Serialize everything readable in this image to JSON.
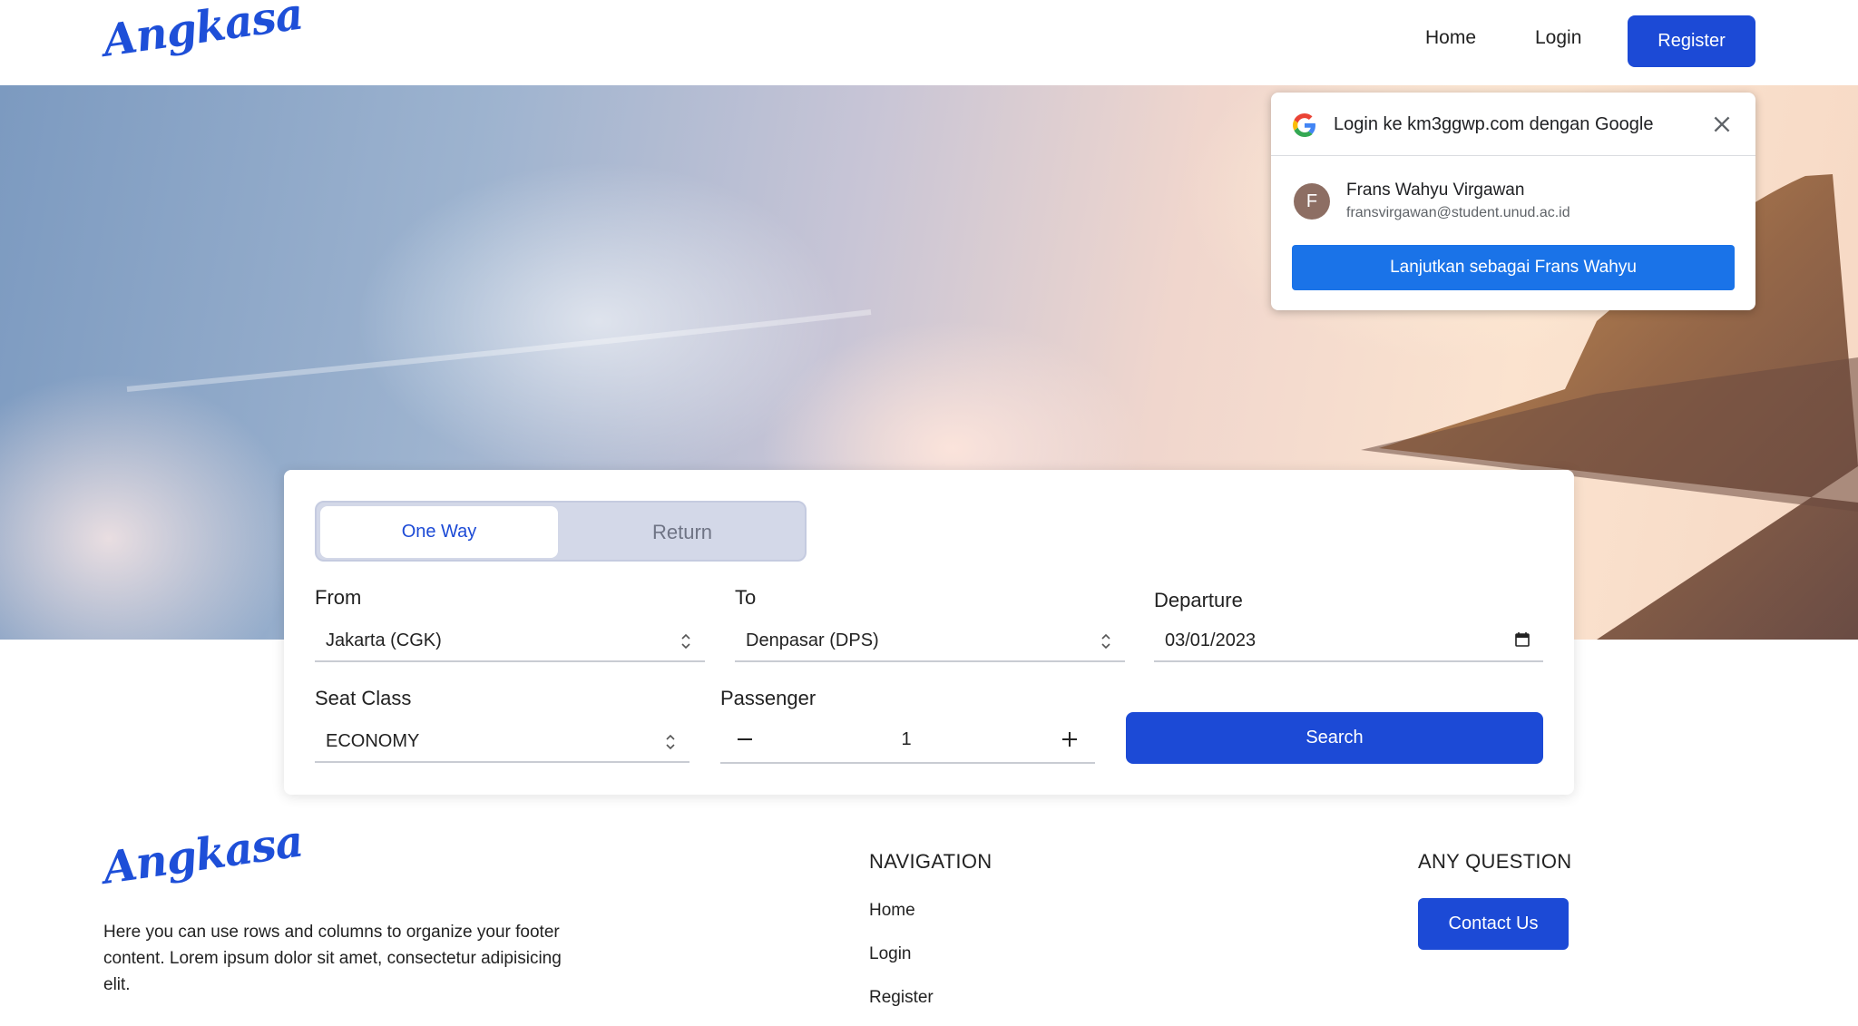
{
  "brand": {
    "logo_text": "Angkasa",
    "accent_color": "#1c4ad6"
  },
  "nav": {
    "home": "Home",
    "login": "Login",
    "register": "Register"
  },
  "google_prompt": {
    "title": "Login ke km3ggwp.com dengan Google",
    "avatar_initial": "F",
    "account_name": "Frans Wahyu Virgawan",
    "account_email": "fransvirgawan@student.unud.ac.id",
    "continue_label": "Lanjutkan sebagai Frans Wahyu",
    "button_color": "#1a73e8"
  },
  "search": {
    "trip_type": {
      "one_way": "One Way",
      "return": "Return",
      "selected": "One Way"
    },
    "from": {
      "label": "From",
      "value": "Jakarta (CGK)"
    },
    "to": {
      "label": "To",
      "value": "Denpasar (DPS)"
    },
    "departure": {
      "label": "Departure",
      "value": "03/01/2023"
    },
    "seat_class": {
      "label": "Seat Class",
      "value": "ECONOMY"
    },
    "passenger": {
      "label": "Passenger",
      "value": "1"
    },
    "search_label": "Search"
  },
  "footer": {
    "logo_text": "Angkasa",
    "description": "Here you can use rows and columns to organize your footer content. Lorem ipsum dolor sit amet, consectetur adipisicing elit.",
    "navigation_heading": "NAVIGATION",
    "links": {
      "home": "Home",
      "login": "Login",
      "register": "Register"
    },
    "question_heading": "ANY QUESTION",
    "contact_label": "Contact Us"
  }
}
